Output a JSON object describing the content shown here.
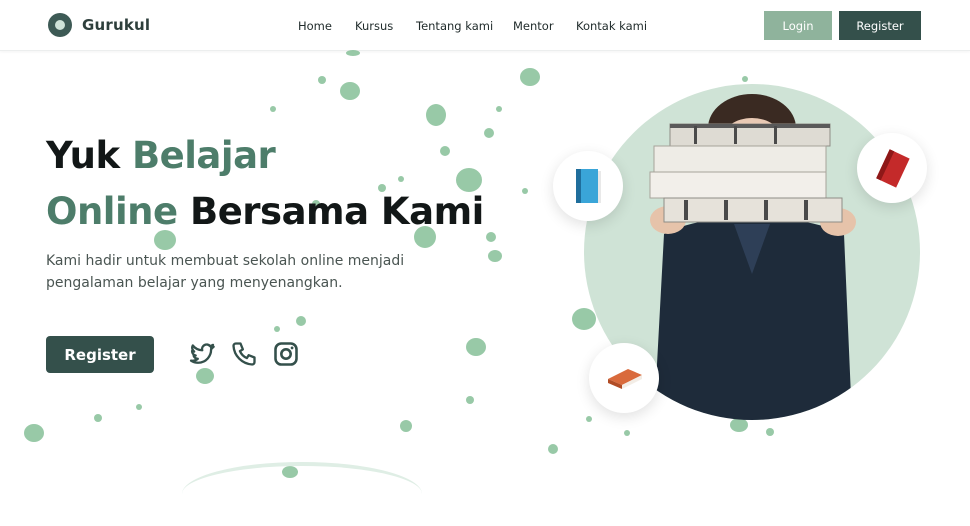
{
  "brand": {
    "name": "Gurukul"
  },
  "nav": {
    "items": [
      "Home",
      "Kursus",
      "Tentang kami",
      "Mentor",
      "Kontak kami"
    ]
  },
  "auth": {
    "login": "Login",
    "register": "Register"
  },
  "hero": {
    "title_line1_dark": "Yuk",
    "title_line1_accent": "Belajar",
    "title_line2_accent": "Online",
    "title_line2_dark": "Bersama Kami",
    "subtitle": "Kami hadir untuk membuat sekolah online menjadi pengalaman belajar yang menyenangkan.",
    "cta": "Register"
  },
  "social": [
    "twitter-icon",
    "phone-icon",
    "instagram-icon"
  ],
  "colors": {
    "primary": "#34504b",
    "accent": "#4d7d6a",
    "login_bg": "#8fb39c",
    "splash": "#86bf98",
    "circle": "#cfe3d6"
  }
}
